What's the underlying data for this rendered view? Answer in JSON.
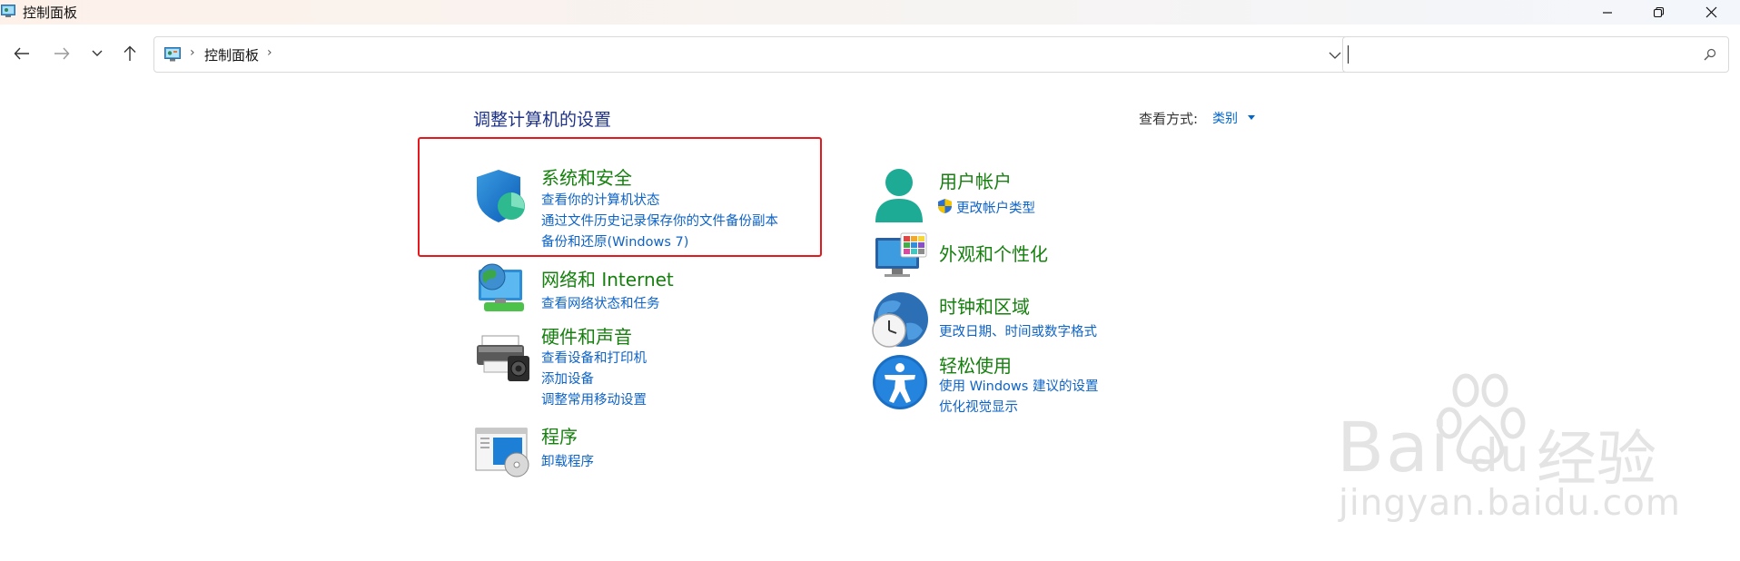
{
  "window": {
    "title": "控制面板"
  },
  "address": {
    "crumb": "控制面板",
    "sep": "›",
    "search_value": ""
  },
  "content": {
    "heading": "调整计算机的设置",
    "view_by_label": "查看方式:",
    "view_by_value": "类别"
  },
  "categories": {
    "system": {
      "title": "系统和安全",
      "icon": "shield-icon",
      "links": [
        "查看你的计算机状态",
        "通过文件历史记录保存你的文件备份副本",
        "备份和还原(Windows 7)"
      ]
    },
    "network": {
      "title": "网络和 Internet",
      "icon": "network-globe-icon",
      "links": [
        "查看网络状态和任务"
      ]
    },
    "hardware": {
      "title": "硬件和声音",
      "icon": "printer-icon",
      "links": [
        "查看设备和打印机",
        "添加设备",
        "调整常用移动设置"
      ]
    },
    "programs": {
      "title": "程序",
      "icon": "programs-icon",
      "links": [
        "卸载程序"
      ]
    },
    "users": {
      "title": "用户帐户",
      "icon": "user-icon",
      "links": [
        "更改帐户类型"
      ]
    },
    "appearance": {
      "title": "外观和个性化",
      "icon": "monitor-palette-icon",
      "links": []
    },
    "clock": {
      "title": "时钟和区域",
      "icon": "clock-globe-icon",
      "links": [
        "更改日期、时间或数字格式"
      ]
    },
    "ease": {
      "title": "轻松使用",
      "icon": "accessibility-icon",
      "links": [
        "使用 Windows 建议的设置",
        "优化视觉显示"
      ]
    }
  },
  "watermark": {
    "logo_text": "Bai",
    "logo_text2": "du",
    "cn": "经验",
    "url": "jingyan.baidu.com"
  },
  "colors": {
    "category_title": "#16800e",
    "link": "#0d63c7",
    "heading": "#1e3287",
    "highlight": "#e5191d"
  }
}
